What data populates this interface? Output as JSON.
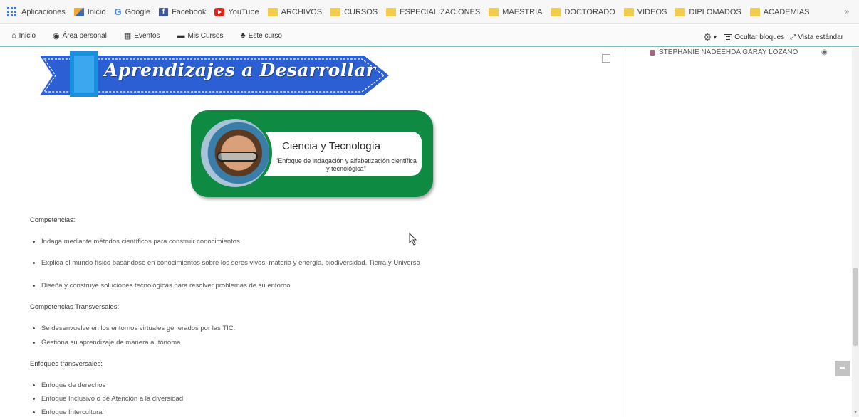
{
  "bookmarks": {
    "apps": "Aplicaciones",
    "items": [
      {
        "label": "Inicio",
        "icon": "inicio-icon"
      },
      {
        "label": "Google",
        "icon": "google-icon"
      },
      {
        "label": "Facebook",
        "icon": "facebook-icon"
      },
      {
        "label": "YouTube",
        "icon": "youtube-icon"
      },
      {
        "label": "ARCHIVOS",
        "icon": "folder-icon"
      },
      {
        "label": "CURSOS",
        "icon": "folder-icon"
      },
      {
        "label": "ESPECIALIZACIONES",
        "icon": "folder-icon"
      },
      {
        "label": "MAESTRIA",
        "icon": "folder-icon"
      },
      {
        "label": "DOCTORADO",
        "icon": "folder-icon"
      },
      {
        "label": "VIDEOS",
        "icon": "folder-icon"
      },
      {
        "label": "DIPLOMADOS",
        "icon": "folder-icon"
      },
      {
        "label": "ACADEMIAS",
        "icon": "folder-icon"
      }
    ],
    "more": "»"
  },
  "nav": {
    "inicio": "Inicio",
    "area_personal": "Área personal",
    "eventos": "Eventos",
    "mis_cursos": "Mis Cursos",
    "este_curso": "Este curso",
    "ocultar_bloques": "Ocultar bloques",
    "vista_estandar": "Vista estándar"
  },
  "sidebar": {
    "user": "STEPHANIE NADEEHDA GARAY LOZANO"
  },
  "banner": {
    "title": "Aprendizajes a Desarrollar"
  },
  "card": {
    "title": "Ciencia y Tecnología",
    "subtitle": "\"Enfoque de indagación y alfabetización científica y tecnológica\""
  },
  "sections": {
    "competencias": {
      "heading": "Competencias:",
      "items": [
        "Indaga mediante métodos científicos para construir conocimientos",
        "Explica el mundo físico basándose en conocimientos sobre los seres vivos; materia y energía, biodiversidad, Tierra y Universo",
        "Diseña y construye soluciones tecnológicas para resolver problemas de su entorno"
      ]
    },
    "transversales": {
      "heading": "Competencias Transversales:",
      "items": [
        "Se desenvuelve en los entornos virtuales generados por las TIC.",
        "Gestiona su aprendizaje de manera autónoma."
      ]
    },
    "enfoques": {
      "heading": "Enfoques transversales:",
      "items": [
        "Enfoque de derechos",
        "Enfoque Inclusivo o de Atención a la diversidad",
        "Enfoque Intercultural"
      ]
    }
  },
  "colors": {
    "accent_teal": "#6cc4bd",
    "banner_blue": "#2c5fd4",
    "card_green": "#0e8a43"
  }
}
